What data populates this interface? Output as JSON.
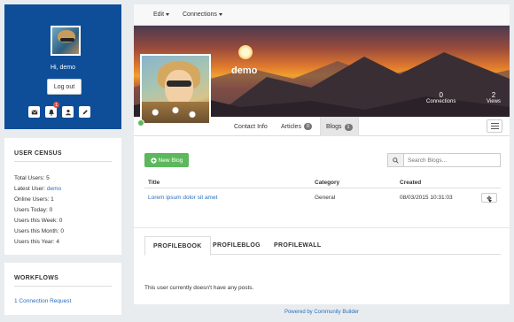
{
  "user_panel": {
    "greeting": "Hi, demo",
    "logout_label": "Log out",
    "icons": [
      "envelope-icon",
      "bell-icon",
      "user-icon",
      "pencil-icon"
    ],
    "notification_count": "1"
  },
  "census": {
    "title": "USER CENSUS",
    "items": [
      {
        "label": "Total Users: 5"
      },
      {
        "label": "Latest User: ",
        "link": "demo"
      },
      {
        "label": "Online Users: 1"
      },
      {
        "label": "Users Today: 0"
      },
      {
        "label": "Users this Week: 0"
      },
      {
        "label": "Users this Month: 0"
      },
      {
        "label": "Users this Year: 4"
      }
    ]
  },
  "workflows": {
    "title": "WORKFLOWS",
    "link": "1 Connection Request"
  },
  "topbar": {
    "edit_label": "Edit",
    "connections_label": "Connections"
  },
  "cover": {
    "username": "demo",
    "connections_count": "0",
    "connections_label": "Connections",
    "views_count": "2",
    "views_label": "Views"
  },
  "profile_tabs": {
    "contact_info": "Contact Info",
    "articles": "Articles",
    "articles_count": "0",
    "blogs": "Blogs",
    "blogs_count": "1"
  },
  "blogs": {
    "new_blog_label": "New Blog",
    "search_placeholder": "Search Blogs...",
    "columns": [
      "Title",
      "Category",
      "Created"
    ],
    "rows": [
      {
        "title": "Lorem ipsum dolor sit amet",
        "category": "General",
        "created": "08/03/2015 10:31:03"
      }
    ]
  },
  "lower_tabs": {
    "profilebook": "PROFILEBOOK",
    "profileblog": "PROFILEBLOG",
    "profilewall": "PROFILEWALL",
    "empty_message": "This user currently doesn't have any posts."
  },
  "footer": {
    "text": "Powered by Community Builder"
  },
  "colors": {
    "brand_blue": "#0e4e99",
    "link": "#2a6ebb",
    "success": "#5cb85c",
    "badge": "#d9534f"
  }
}
